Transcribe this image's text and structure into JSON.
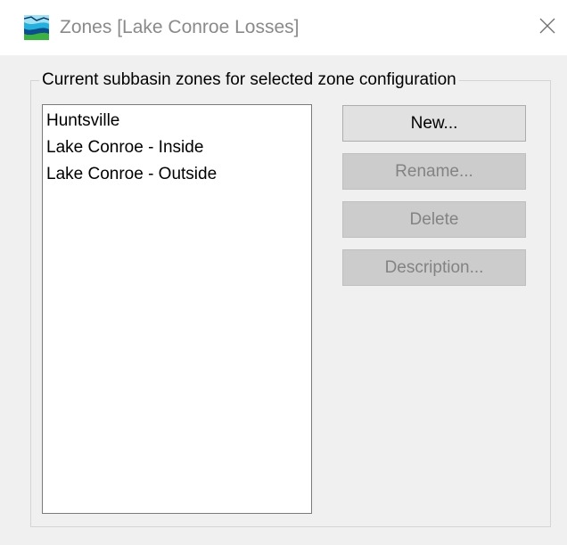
{
  "window": {
    "title": "Zones [Lake Conroe Losses]",
    "app_icon": "hec-hms-icon",
    "close_icon": "close-icon"
  },
  "group": {
    "label": "Current subbasin zones for selected zone configuration"
  },
  "zones": {
    "items": [
      {
        "label": "Huntsville"
      },
      {
        "label": "Lake Conroe - Inside"
      },
      {
        "label": "Lake Conroe - Outside"
      }
    ]
  },
  "buttons": {
    "new": {
      "label": "New...",
      "enabled": true
    },
    "rename": {
      "label": "Rename...",
      "enabled": false
    },
    "delete": {
      "label": "Delete",
      "enabled": false
    },
    "description": {
      "label": "Description...",
      "enabled": false
    }
  },
  "colors": {
    "dialog_background": "#f0f0f0",
    "titlebar_background": "#ffffff",
    "title_text": "#8a8a8a",
    "disabled_text": "#838383"
  }
}
